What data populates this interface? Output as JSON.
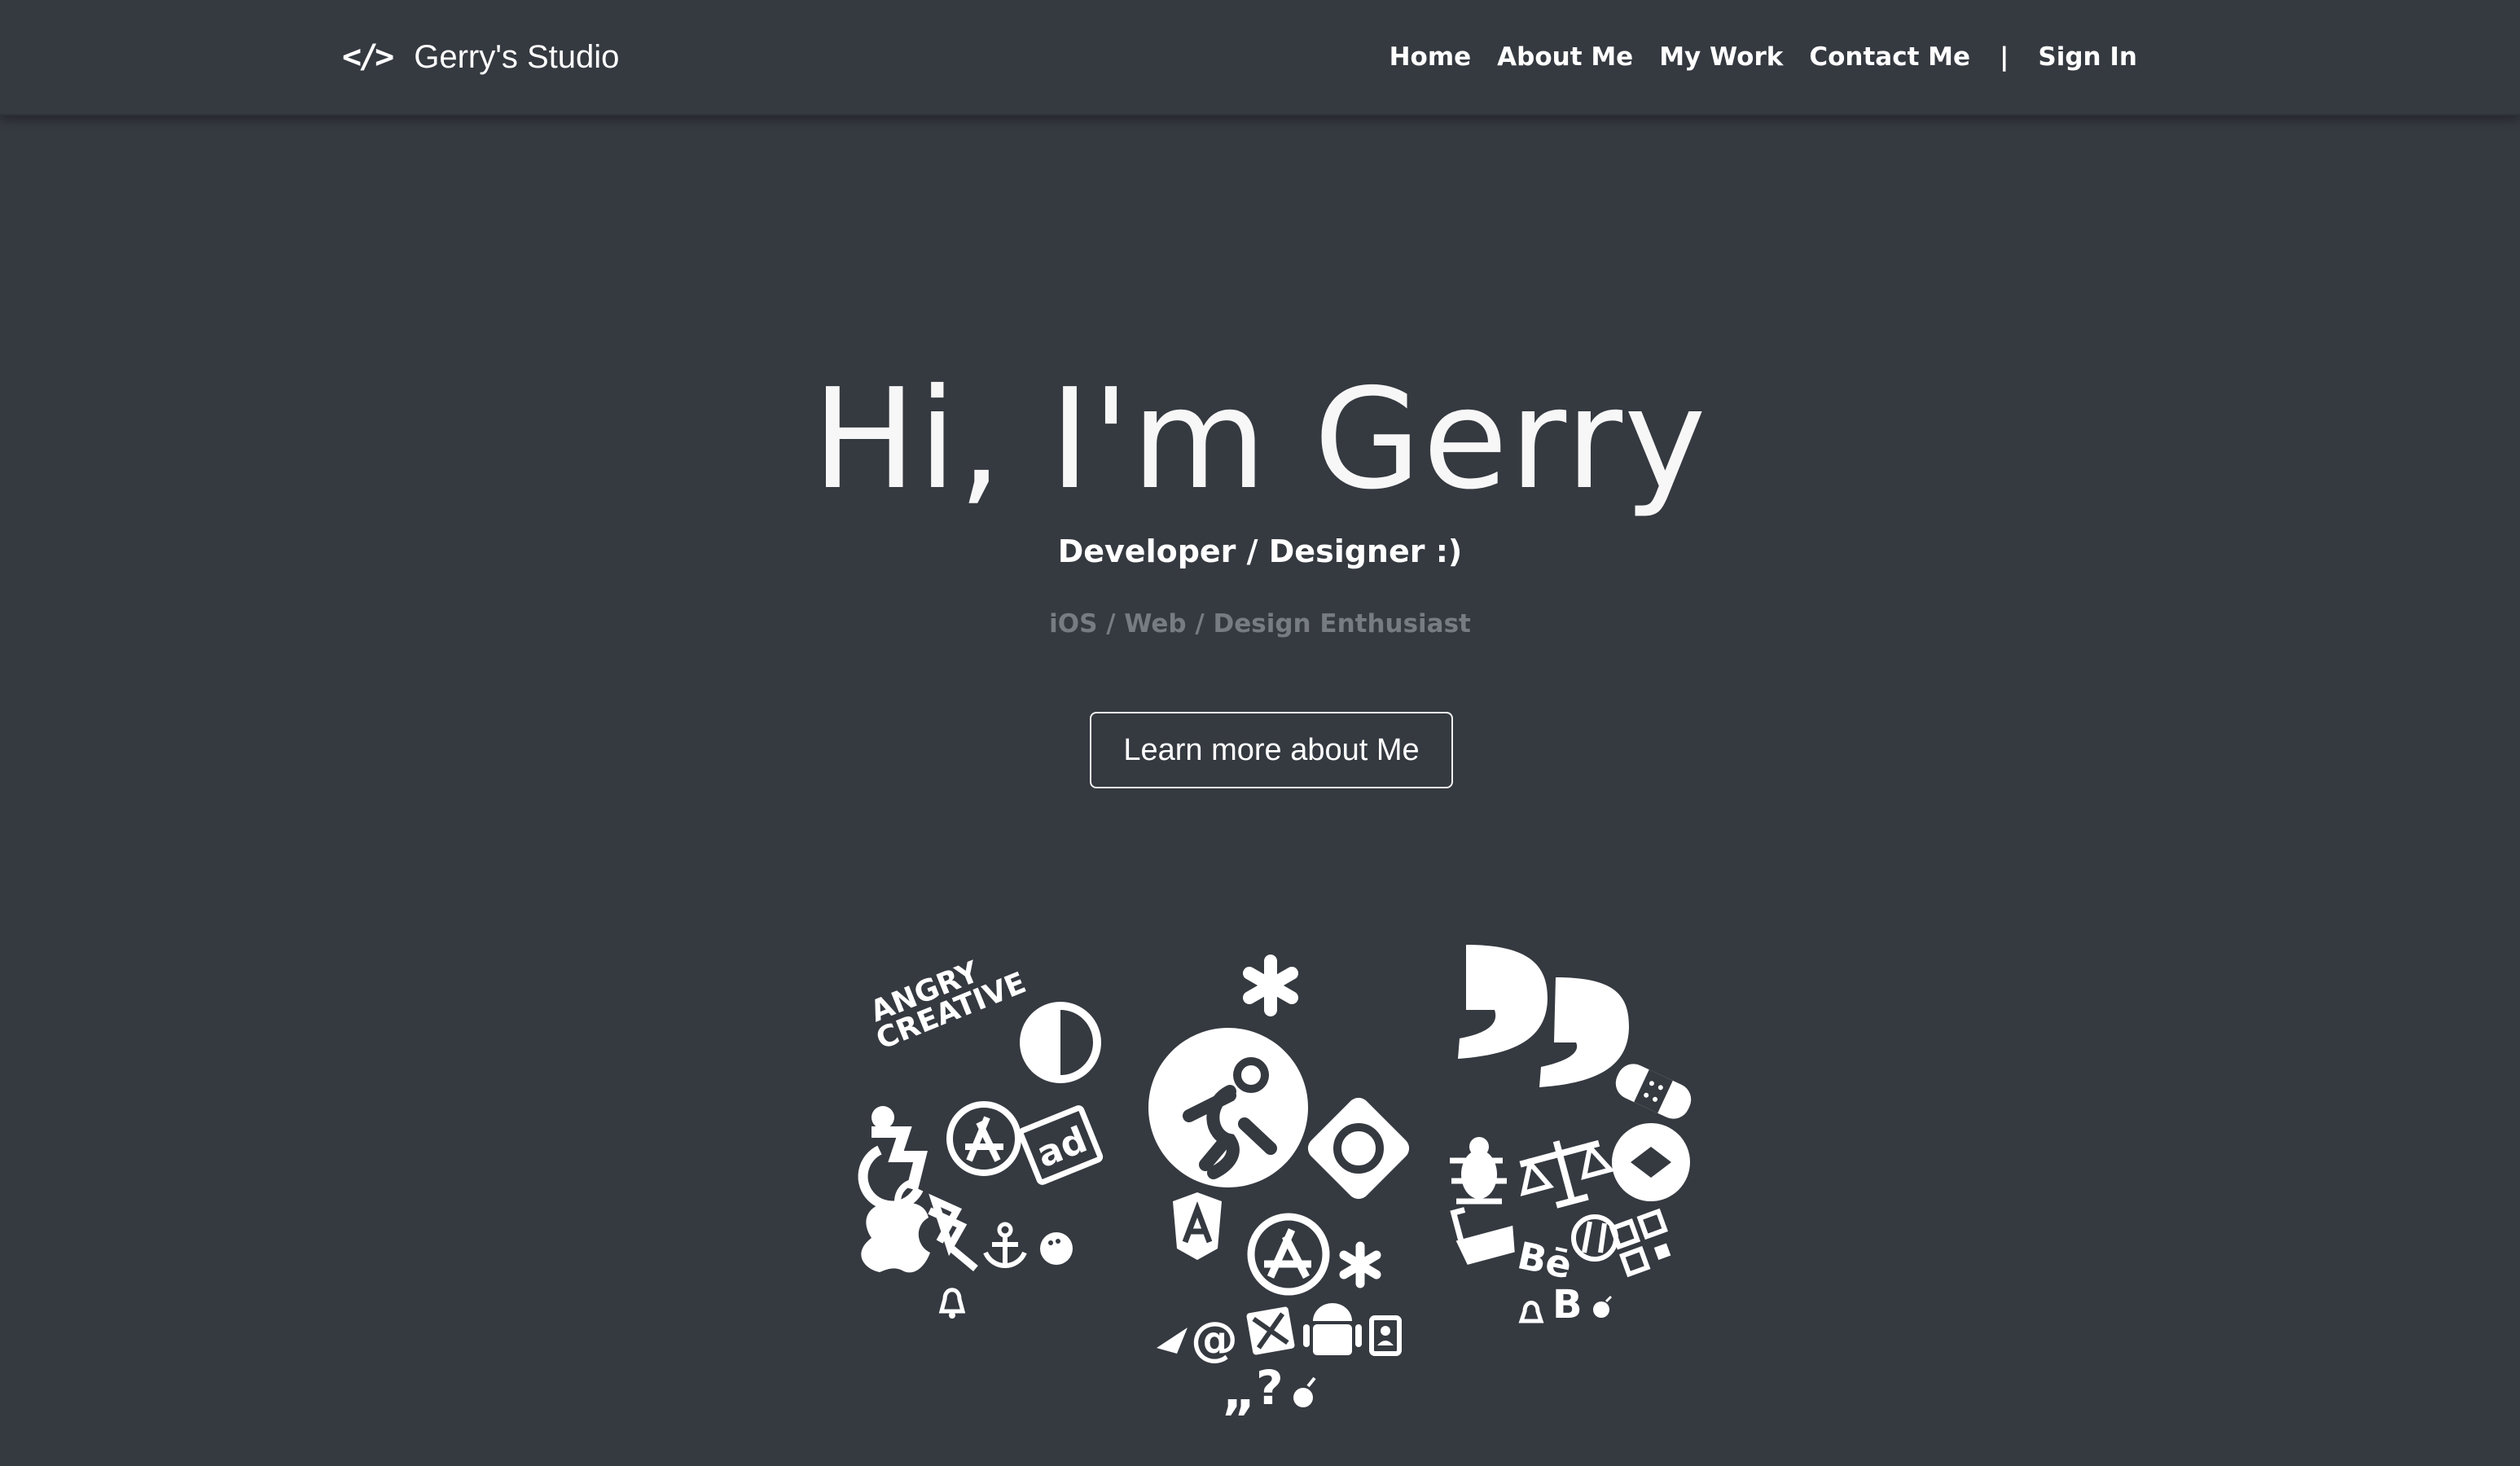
{
  "navbar": {
    "brand_icon": "</>",
    "brand_name": "Gerry's Studio",
    "links": [
      "Home",
      "About Me",
      "My Work",
      "Contact Me"
    ],
    "separator": "|",
    "sign_in": "Sign In"
  },
  "hero": {
    "title": "Hi, I'm Gerry",
    "role": "Developer / Designer :)",
    "subtitle": "iOS / Web / Design Enthusiast",
    "cta_label": "Learn more about Me"
  },
  "illustration": {
    "brand_marks": [
      "ANGRY",
      "CREATIVE",
      "ad",
      "Bē",
      "B"
    ],
    "icons": [
      "angry-creative-icon",
      "half-circle-icon",
      "accessible-icon",
      "app-store-icon",
      "adversal-icon",
      "apple-icon",
      "bluetooth-icon",
      "anchor-icon",
      "bowling-ball-icon",
      "bell-icon",
      "asterisk-icon",
      "astronaut-icon",
      "gg-icon",
      "angular-icon",
      "app-store-circle-icon",
      "asterisk-small-icon",
      "paper-plane-icon",
      "at-icon",
      "pencil-ruler-icon",
      "android-icon",
      "address-book-icon",
      "quote-icon",
      "question-icon",
      "bomb-icon",
      "quote-large-icon",
      "bandage-icon",
      "bug-icon",
      "balance-scale-icon",
      "diamond-circle-icon",
      "bath-icon",
      "behance-icon",
      "peace-hand-icon",
      "barcode-icon",
      "bitcoin-icon"
    ],
    "colors": {
      "background": "#353940",
      "icon": "#ffffff",
      "muted_text": "#777c83"
    }
  }
}
